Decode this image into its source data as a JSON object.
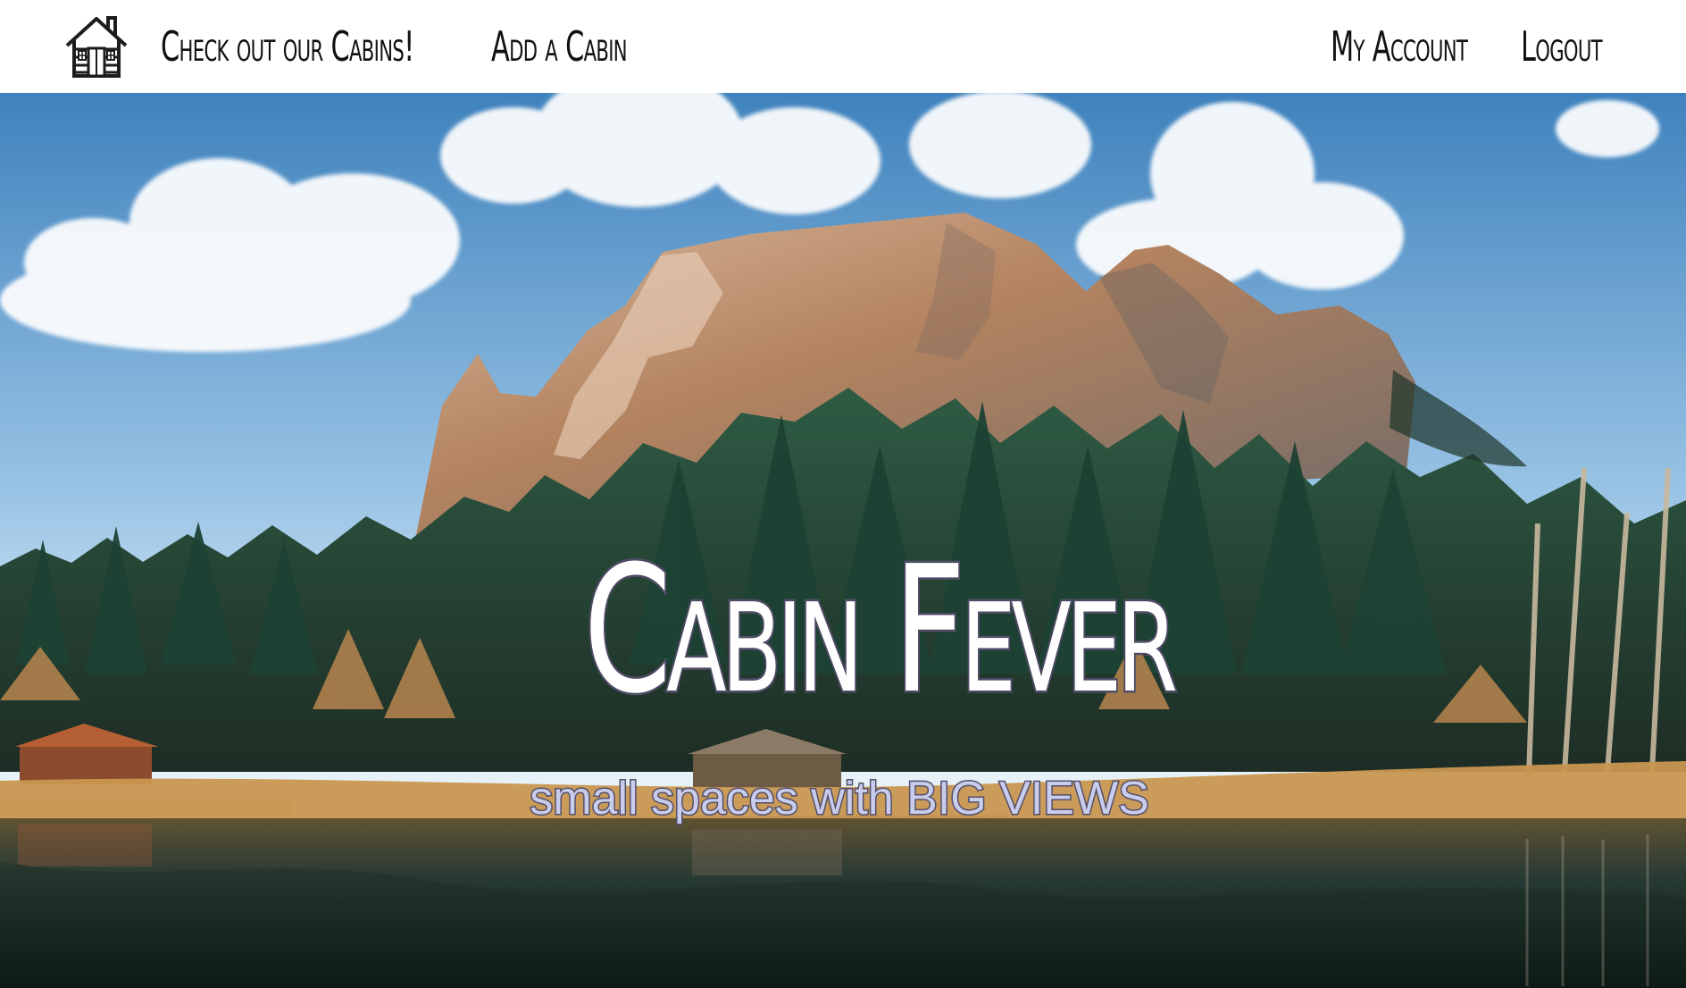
{
  "navigation": {
    "logo_icon": "cabin-icon",
    "links": {
      "cabins": "Check out our Cabins!",
      "add_cabin": "Add a Cabin",
      "account": "My Account",
      "logout": "Logout"
    }
  },
  "hero": {
    "title": "Cabin Fever",
    "subtitle": "small spaces with BIG VIEWS"
  }
}
